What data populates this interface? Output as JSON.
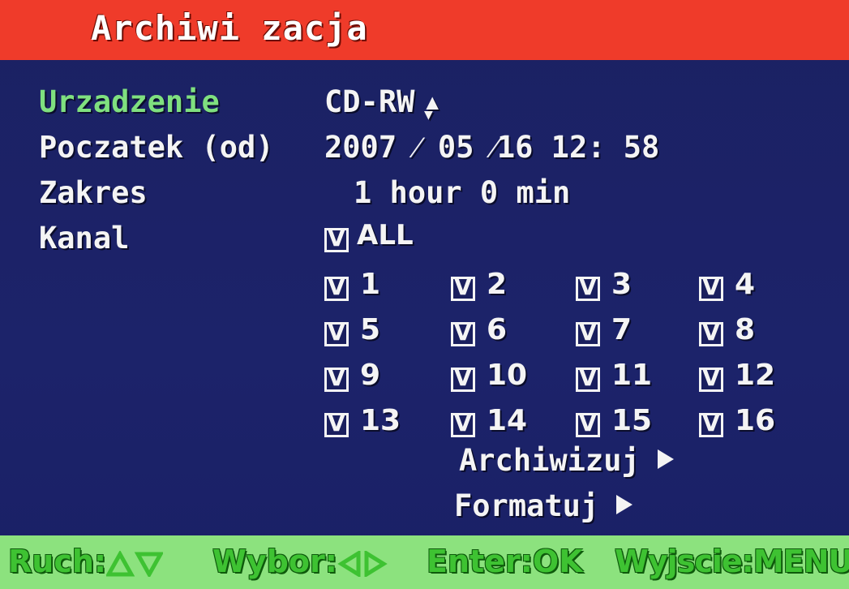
{
  "title": "Archiwi zacja",
  "rows": {
    "device": {
      "label": "Urzadzenie",
      "value": "CD-RW",
      "selector_icon": "up-down-arrow-icon"
    },
    "start": {
      "label": "Poczatek (od)",
      "value": "2007 ⁄ 05 ⁄16 12: 58"
    },
    "range": {
      "label": "Zakres",
      "value": "1 hour 0 min"
    },
    "channel": {
      "label": "Kanal",
      "all_label": "ALL"
    }
  },
  "checkbox_mark": "V",
  "channels": [
    "1",
    "2",
    "3",
    "4",
    "5",
    "6",
    "7",
    "8",
    "9",
    "10",
    "11",
    "12",
    "13",
    "14",
    "15",
    "16"
  ],
  "actions": {
    "archive": "Archiwizuj",
    "format": "Formatuj"
  },
  "status": {
    "move": "Ruch:",
    "select": "Wybor:",
    "enter": "Enter:OK",
    "exit": "Wyjscie:MENU"
  },
  "colors": {
    "title_bar": "#ef3b2a",
    "background": "#1b2163",
    "active_label": "#7fe07f",
    "status_bar": "#8ce27e",
    "status_text": "#3ec232"
  }
}
